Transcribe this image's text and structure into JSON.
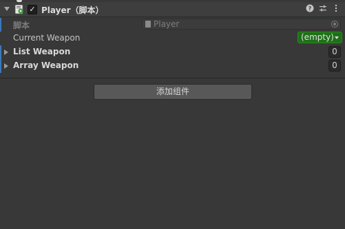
{
  "component": {
    "title": "Player（脚本）",
    "enabled": true,
    "checkmark_glyph": "✓",
    "header_icons": [
      "help-icon",
      "preset-icon",
      "more-icon"
    ]
  },
  "properties": {
    "script_label": "脚本",
    "script_value": "Player",
    "current_weapon_label": "Current Weapon",
    "current_weapon_value": "(empty)",
    "list_weapon_label": "List Weapon",
    "list_weapon_size": "0",
    "array_weapon_label": "Array Weapon",
    "array_weapon_size": "0"
  },
  "actions": {
    "add_component_label": "添加组件"
  },
  "colors": {
    "background": "#383838",
    "accent": "#3a79bb",
    "dropdown_green": "#1f6f18"
  }
}
